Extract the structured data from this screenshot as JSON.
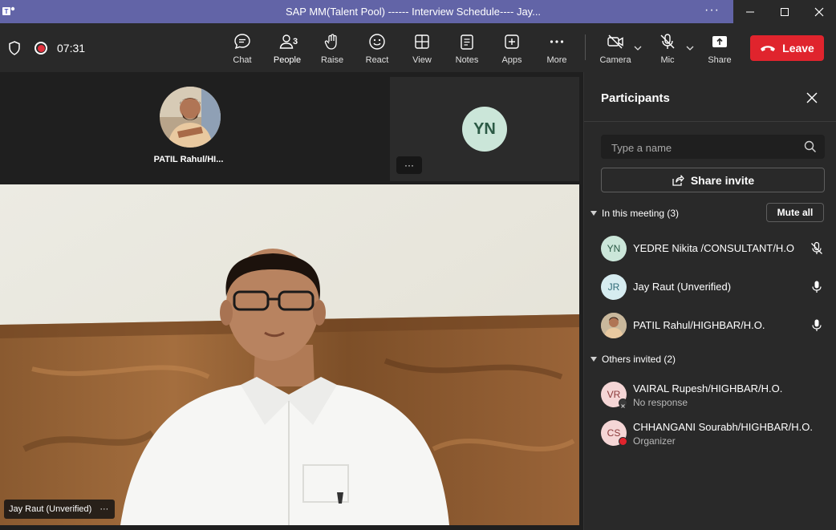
{
  "window": {
    "title": "SAP MM(Talent Pool) ------ Interview Schedule---- Jay...",
    "more_label": "···"
  },
  "toolbar": {
    "timer": "07:31",
    "buttons": {
      "chat": "Chat",
      "people": "People",
      "people_count": "3",
      "raise": "Raise",
      "react": "React",
      "view": "View",
      "notes": "Notes",
      "apps": "Apps",
      "more": "More",
      "camera": "Camera",
      "mic": "Mic",
      "share": "Share"
    },
    "leave": "Leave",
    "accent_color": "#7f85f5",
    "leave_color": "#e0242d"
  },
  "stage": {
    "patil_tile_name": "PATIL Rahul/HI...",
    "yn_initials": "YN",
    "yn_more": "···",
    "main_video_name": "Jay Raut (Unverified)",
    "main_more": "···"
  },
  "panel": {
    "title": "Participants",
    "search_placeholder": "Type a name",
    "share_invite": "Share invite",
    "in_meeting_label": "In this meeting (3)",
    "mute_all": "Mute all",
    "others_invited_label": "Others invited (2)",
    "in_meeting": [
      {
        "initials": "YN",
        "name": "YEDRE Nikita /CONSULTANT/H.O",
        "mic": "mic-muted-icon"
      },
      {
        "initials": "JR",
        "name": "Jay Raut (Unverified)",
        "mic": "mic-icon"
      },
      {
        "initials": "",
        "name": "PATIL Rahul/HIGHBAR/H.O.",
        "mic": "mic-icon"
      }
    ],
    "invited": [
      {
        "initials": "VR",
        "name": "VAIRAL Rupesh/HIGHBAR/H.O.",
        "status": "No response"
      },
      {
        "initials": "CS",
        "name": "CHHANGANI Sourabh/HIGHBAR/H.O.",
        "status": "Organizer"
      }
    ]
  }
}
